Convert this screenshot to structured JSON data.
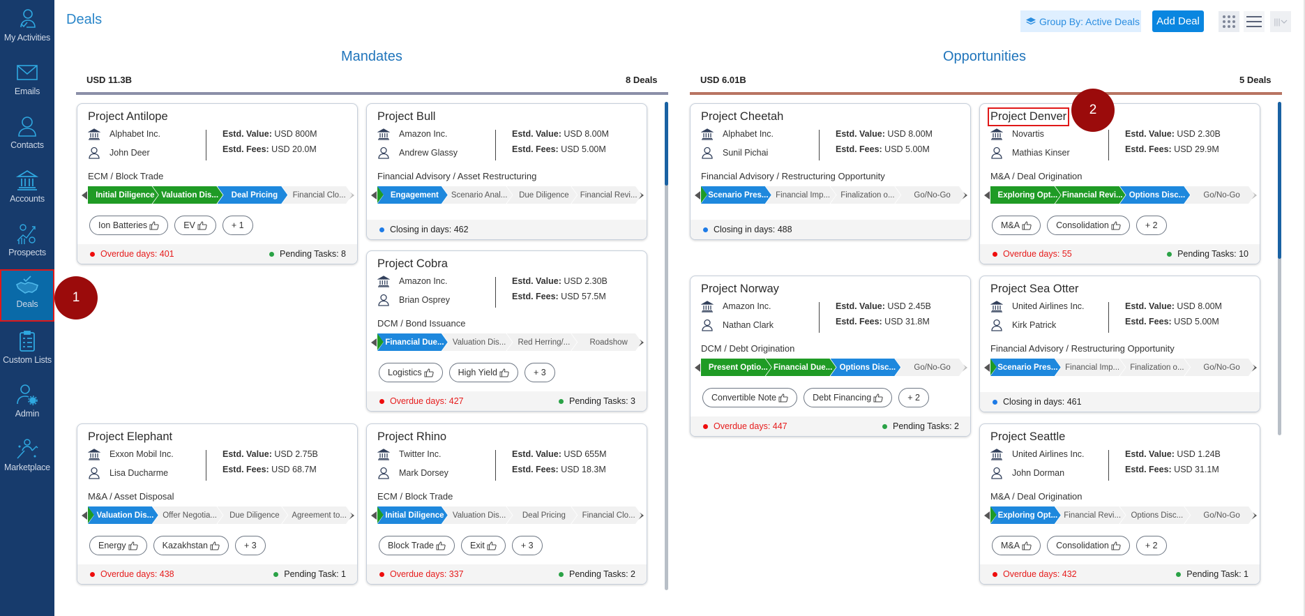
{
  "sidebar": {
    "items": [
      {
        "label": "My Activities",
        "icon": "user-check-icon"
      },
      {
        "label": "Emails",
        "icon": "envelope-icon"
      },
      {
        "label": "Contacts",
        "icon": "contact-icon"
      },
      {
        "label": "Accounts",
        "icon": "bank-icon"
      },
      {
        "label": "Prospects",
        "icon": "chart-gears-icon"
      },
      {
        "label": "Deals",
        "icon": "handshake-icon",
        "active": true
      },
      {
        "label": "Custom Lists",
        "icon": "clipboard-list-icon"
      },
      {
        "label": "Admin",
        "icon": "user-gear-icon"
      },
      {
        "label": "Marketplace",
        "icon": "marketplace-icon"
      }
    ]
  },
  "markers": {
    "m1": "1",
    "m2": "2"
  },
  "header": {
    "title": "Deals",
    "group_by": "Group By: Active Deals",
    "add_deal": "Add Deal",
    "view_column_icon": "|||"
  },
  "colors": {
    "sidebar_bg": "#173b6c",
    "accent": "#1f74bb",
    "done_stage": "#1f9b25",
    "current_stage": "#1e88dd",
    "mandates_bar": "#8b8fa8",
    "opportunities_bar": "#b87462",
    "overdue": "#e61b1b"
  },
  "columns": {
    "mandates": {
      "title": "Mandates",
      "total": "USD 11.3B",
      "count": "8 Deals",
      "cards": [
        {
          "title": "Project Antilope",
          "account": "Alphabet Inc.",
          "contact": "John Deer",
          "value_label": "Estd. Value:",
          "value": "USD 800M",
          "fees_label": "Estd. Fees:",
          "fees": "USD 20.0M",
          "category": "ECM / Block Trade",
          "stages": [
            {
              "label": "Initial Diligence",
              "state": "done"
            },
            {
              "label": "Valuation Dis...",
              "state": "done"
            },
            {
              "label": "Deal Pricing",
              "state": "current"
            },
            {
              "label": "Financial Clo...",
              "state": "todo"
            }
          ],
          "tags": [
            "Ion Batteries",
            "EV"
          ],
          "more": "+ 1",
          "overdue": "Overdue days: 401",
          "pending": "Pending Tasks: 8"
        },
        {
          "title": "Project Bull",
          "account": "Amazon Inc.",
          "contact": "Andrew Glassy",
          "value_label": "Estd. Value:",
          "value": "USD 8.00M",
          "fees_label": "Estd. Fees:",
          "fees": "USD 5.00M",
          "category": "Financial Advisory / Asset Restructuring",
          "stages": [
            {
              "label": "Engagement",
              "state": "current"
            },
            {
              "label": "Scenario Anal...",
              "state": "todo"
            },
            {
              "label": "Due Diligence",
              "state": "todo"
            },
            {
              "label": "Financial Revi...",
              "state": "todo"
            }
          ],
          "tags": [],
          "more": "",
          "closing": "Closing in days: 462"
        },
        {
          "title": "Project Cobra",
          "account": "Amazon Inc.",
          "contact": "Brian Osprey",
          "value_label": "Estd. Value:",
          "value": "USD 2.30B",
          "fees_label": "Estd. Fees:",
          "fees": "USD 57.5M",
          "category": "DCM / Bond Issuance",
          "stages": [
            {
              "label": "Financial Due...",
              "state": "current"
            },
            {
              "label": "Valuation Dis...",
              "state": "todo"
            },
            {
              "label": "Red Herring/...",
              "state": "todo"
            },
            {
              "label": "Roadshow",
              "state": "todo"
            }
          ],
          "tags": [
            "Logistics",
            "High Yield"
          ],
          "more": "+ 3",
          "overdue": "Overdue days: 427",
          "pending": "Pending Tasks: 3"
        },
        {
          "title": "Project Elephant",
          "account": "Exxon Mobil Inc.",
          "contact": "Lisa Ducharme",
          "value_label": "Estd. Value:",
          "value": "USD 2.75B",
          "fees_label": "Estd. Fees:",
          "fees": "USD 68.7M",
          "category": "M&A / Asset Disposal",
          "stages": [
            {
              "label": "Valuation Dis...",
              "state": "current"
            },
            {
              "label": "Offer Negotia...",
              "state": "todo"
            },
            {
              "label": "Due Diligence",
              "state": "todo"
            },
            {
              "label": "Agreement to...",
              "state": "todo"
            }
          ],
          "tags": [
            "Energy",
            "Kazakhstan"
          ],
          "more": "+ 3",
          "overdue": "Overdue days: 438",
          "pending": "Pending Task: 1"
        },
        {
          "title": "Project Rhino",
          "account": "Twitter Inc.",
          "contact": "Mark Dorsey",
          "value_label": "Estd. Value:",
          "value": "USD 655M",
          "fees_label": "Estd. Fees:",
          "fees": "USD 18.3M",
          "category": "ECM / Block Trade",
          "stages": [
            {
              "label": "Initial Diligence",
              "state": "current"
            },
            {
              "label": "Valuation Dis...",
              "state": "todo"
            },
            {
              "label": "Deal Pricing",
              "state": "todo"
            },
            {
              "label": "Financial Clo...",
              "state": "todo"
            }
          ],
          "tags": [
            "Block Trade",
            "Exit"
          ],
          "more": "+ 3",
          "overdue": "Overdue days: 337",
          "pending": "Pending Tasks: 2"
        }
      ]
    },
    "opportunities": {
      "title": "Opportunities",
      "total": "USD 6.01B",
      "count": "5 Deals",
      "cards": [
        {
          "title": "Project Cheetah",
          "account": "Alphabet Inc.",
          "contact": "Sunil Pichai",
          "value_label": "Estd. Value:",
          "value": "USD 8.00M",
          "fees_label": "Estd. Fees:",
          "fees": "USD 5.00M",
          "category": "Financial Advisory / Restructuring Opportunity",
          "stages": [
            {
              "label": "Scenario Pres...",
              "state": "current"
            },
            {
              "label": "Financial Imp...",
              "state": "todo"
            },
            {
              "label": "Finalization o...",
              "state": "todo"
            },
            {
              "label": "Go/No-Go",
              "state": "todo"
            }
          ],
          "tags": [],
          "more": "",
          "closing": "Closing in days: 488"
        },
        {
          "title": "Project Denver",
          "account": "Novartis",
          "contact": "Mathias Kinser",
          "value_label": "Estd. Value:",
          "value": "USD 2.30B",
          "fees_label": "Estd. Fees:",
          "fees": "USD 29.9M",
          "category": "M&A / Deal Origination",
          "stages": [
            {
              "label": "Exploring Opt...",
              "state": "done"
            },
            {
              "label": "Financial Revi...",
              "state": "done"
            },
            {
              "label": "Options Disc...",
              "state": "current"
            },
            {
              "label": "Go/No-Go",
              "state": "todo"
            }
          ],
          "tags": [
            "M&A",
            "Consolidation"
          ],
          "more": "+ 2",
          "overdue": "Overdue days: 55",
          "pending": "Pending Tasks: 10"
        },
        {
          "title": "Project Norway",
          "account": "Amazon Inc.",
          "contact": "Nathan Clark",
          "value_label": "Estd. Value:",
          "value": "USD 2.45B",
          "fees_label": "Estd. Fees:",
          "fees": "USD 31.8M",
          "category": "DCM / Debt Origination",
          "stages": [
            {
              "label": "Present Optio...",
              "state": "done"
            },
            {
              "label": "Financial Due...",
              "state": "done"
            },
            {
              "label": "Options Disc...",
              "state": "current"
            },
            {
              "label": "Go/No-Go",
              "state": "todo"
            }
          ],
          "tags": [
            "Convertible Note",
            "Debt Financing"
          ],
          "more": "+ 2",
          "overdue": "Overdue days: 447",
          "pending": "Pending Tasks: 2"
        },
        {
          "title": "Project Sea Otter",
          "account": "United Airlines Inc.",
          "contact": "Kirk Patrick",
          "value_label": "Estd. Value:",
          "value": "USD 8.00M",
          "fees_label": "Estd. Fees:",
          "fees": "USD 5.00M",
          "category": "Financial Advisory / Restructuring Opportunity",
          "stages": [
            {
              "label": "Scenario Pres...",
              "state": "current"
            },
            {
              "label": "Financial Imp...",
              "state": "todo"
            },
            {
              "label": "Finalization o...",
              "state": "todo"
            },
            {
              "label": "Go/No-Go",
              "state": "todo"
            }
          ],
          "tags": [],
          "more": "",
          "closing": "Closing in days: 461"
        },
        {
          "title": "Project Seattle",
          "account": "United Airlines Inc.",
          "contact": "John Dorman",
          "value_label": "Estd. Value:",
          "value": "USD 1.24B",
          "fees_label": "Estd. Fees:",
          "fees": "USD 31.1M",
          "category": "M&A / Deal Origination",
          "stages": [
            {
              "label": "Exploring Opt...",
              "state": "current"
            },
            {
              "label": "Financial Revi...",
              "state": "todo"
            },
            {
              "label": "Options Disc...",
              "state": "todo"
            },
            {
              "label": "Go/No-Go",
              "state": "todo"
            }
          ],
          "tags": [
            "M&A",
            "Consolidation"
          ],
          "more": "+ 2",
          "overdue": "Overdue days: 432",
          "pending": "Pending Task: 1"
        }
      ]
    }
  }
}
